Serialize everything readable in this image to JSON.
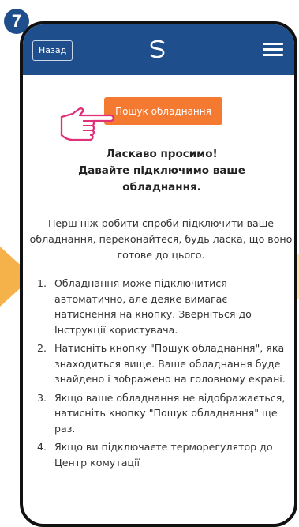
{
  "step_number": "7",
  "header": {
    "back_label": "Назад",
    "logo_icon": "salus-logo-icon",
    "menu_icon": "hamburger-menu-icon"
  },
  "search_button_label": "Пошук обладнання",
  "welcome": {
    "line1": "Ласкаво просимо!",
    "line2": "Давайте підключимо ваше",
    "line3": "обладнання."
  },
  "intro": "Перш ніж робити спроби підключити ваше обладнання, переконайтеся, будь ласка, що воно готове до цього.",
  "instructions": [
    {
      "number": "1.",
      "text": "Обладнання може підключитися автоматично, але деяке вимагає натиснення на кнопку. Зверніться до Інструкції користувача."
    },
    {
      "number": "2.",
      "text": "Натисніть кнопку \"Пошук обладнання\", яка знаходиться вище. Ваше обладнання буде знайдено і зображено на головному екрані."
    },
    {
      "number": "3.",
      "text": "Якщо ваше обладнання не відображається, натисніть кнопку \"Пошук обладнання\" ще раз."
    },
    {
      "number": "4.",
      "text": "Якщо ви підключаєте терморегулятор до Центр комутації"
    }
  ],
  "colors": {
    "header_bg": "#1e4e8c",
    "button_bg": "#f47a32",
    "hand_outline": "#e0307a",
    "arrow": "#f5b24a"
  }
}
